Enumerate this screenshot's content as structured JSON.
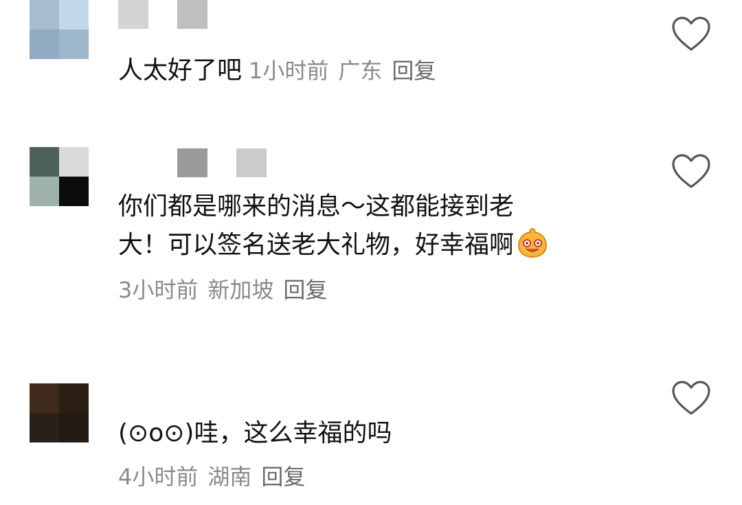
{
  "comments": [
    {
      "avatar_colors": [
        "#a8bcd0",
        "#c2d8ea",
        "#8faac1",
        "#9db6cb"
      ],
      "name_blur_colors": [
        "#d4d4d4",
        "#bfbfbf"
      ],
      "text": "人太好了吧",
      "time": "1小时前",
      "location": "广东",
      "reply": "回复",
      "like_icon": "heart-outline-icon"
    },
    {
      "avatar_colors": [
        "#4e615b",
        "#d9dbda",
        "#9fb1ac",
        "#0b0d0b"
      ],
      "name_blur_colors": [
        "#9a9a9a",
        "#cbcbcb"
      ],
      "text_line1": "你们都是哪来的消息～这都能接到老",
      "text_line2": "大！可以签名送老大礼物，好幸福啊",
      "emoji": "smiling-face-emoji",
      "time": "3小时前",
      "location": "新加坡",
      "reply": "回复",
      "like_icon": "heart-outline-icon"
    },
    {
      "avatar_colors": [
        "#3f2a1b",
        "#2c2015",
        "#2a201a",
        "#231a14"
      ],
      "text": "(⊙o⊙)哇，这么幸福的吗",
      "time": "4小时前",
      "location": "湖南",
      "reply": "回复",
      "like_icon": "heart-outline-icon"
    }
  ]
}
